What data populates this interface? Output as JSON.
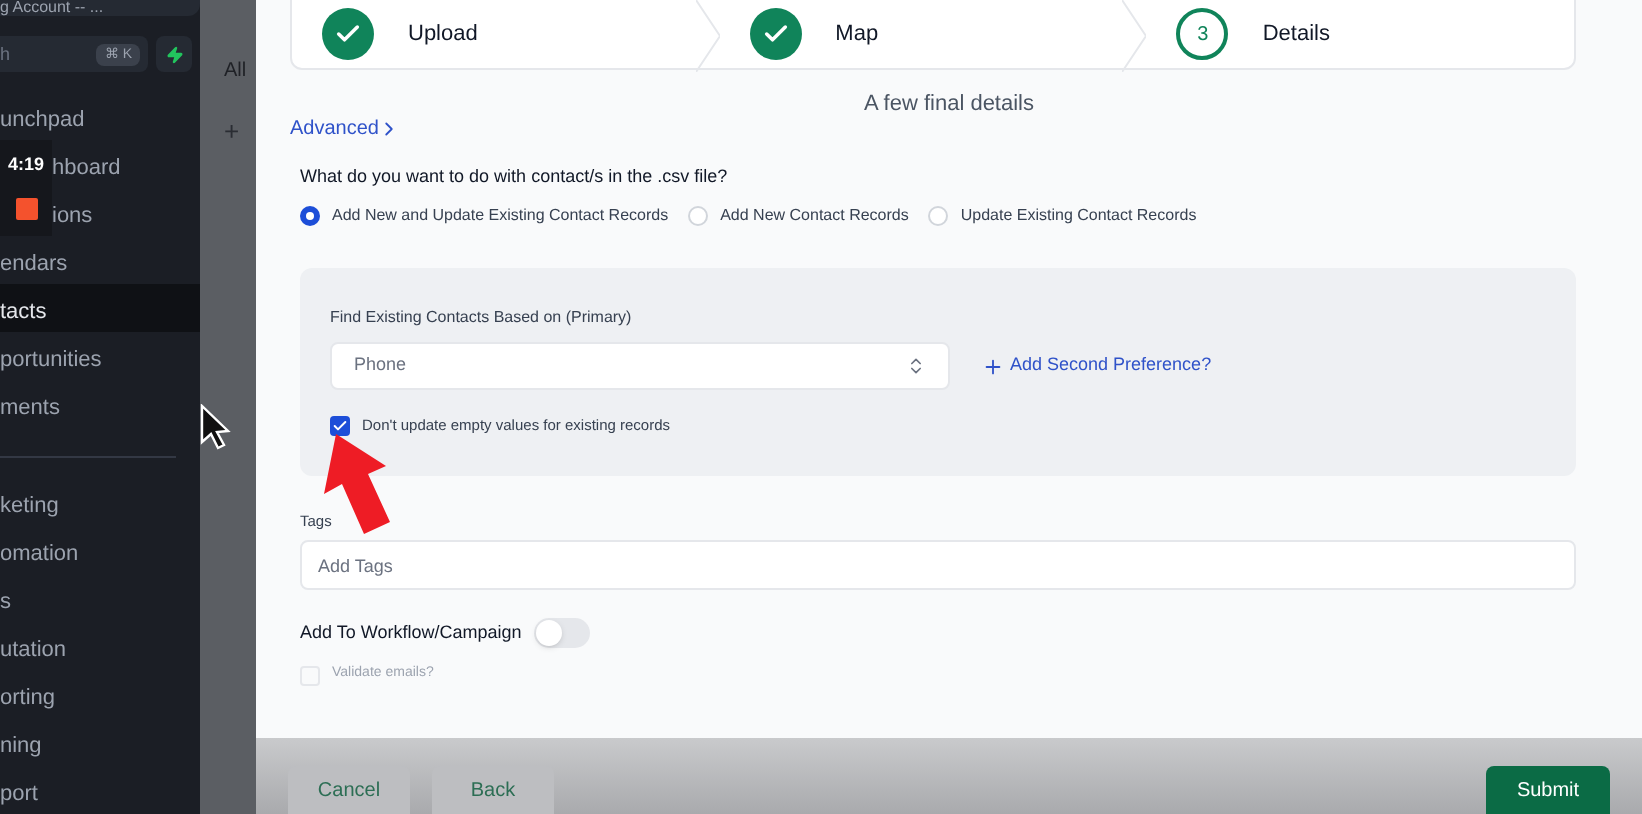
{
  "sidebar": {
    "account": "g Account -- ...",
    "search": {
      "placeholder": "h",
      "shortcut": "⌘ K"
    },
    "items_top": [
      {
        "label": "unchpad",
        "selected": false
      },
      {
        "label": "hboard",
        "selected": false
      },
      {
        "label": "ions",
        "selected": false
      },
      {
        "label": "endars",
        "selected": false
      },
      {
        "label": "tacts",
        "selected": true
      },
      {
        "label": "portunities",
        "selected": false
      },
      {
        "label": "ments",
        "selected": false
      }
    ],
    "items_bottom": [
      {
        "label": "keting",
        "selected": false
      },
      {
        "label": "omation",
        "selected": false
      },
      {
        "label": "s",
        "selected": false
      },
      {
        "label": "utation",
        "selected": false
      },
      {
        "label": "orting",
        "selected": false
      },
      {
        "label": "ning",
        "selected": false
      },
      {
        "label": "port",
        "selected": false
      }
    ]
  },
  "recorder": {
    "time": "4:19"
  },
  "background": {
    "tab": "All",
    "add": "+"
  },
  "steps": [
    {
      "label": "Upload",
      "done": true
    },
    {
      "label": "Map",
      "done": true
    },
    {
      "label": "Details",
      "done": false,
      "number": "3"
    }
  ],
  "heading": "A few final details",
  "advanced_link": "Advanced",
  "question": "What do you want to do with contact/s in the .csv file?",
  "options": [
    {
      "label": "Add New and Update Existing Contact Records",
      "selected": true
    },
    {
      "label": "Add New Contact Records",
      "selected": false
    },
    {
      "label": "Update Existing Contact Records",
      "selected": false
    }
  ],
  "match": {
    "label": "Find Existing Contacts Based on (Primary)",
    "value": "Phone",
    "add_link": "Add Second Preference?",
    "keep_empty": {
      "label": "Don't update empty values for existing records",
      "checked": true
    }
  },
  "tags": {
    "label": "Tags",
    "placeholder": "Add Tags"
  },
  "workflow": {
    "label": "Add To Workflow/Campaign",
    "on": false
  },
  "validate": {
    "label": "Validate emails?",
    "checked": false,
    "disabled": true
  },
  "footer": {
    "buttons": [
      {
        "label": "Cancel",
        "kind": "plain"
      },
      {
        "label": "Back",
        "kind": "plain"
      },
      {
        "label": "Submit",
        "kind": "primary"
      }
    ]
  }
}
